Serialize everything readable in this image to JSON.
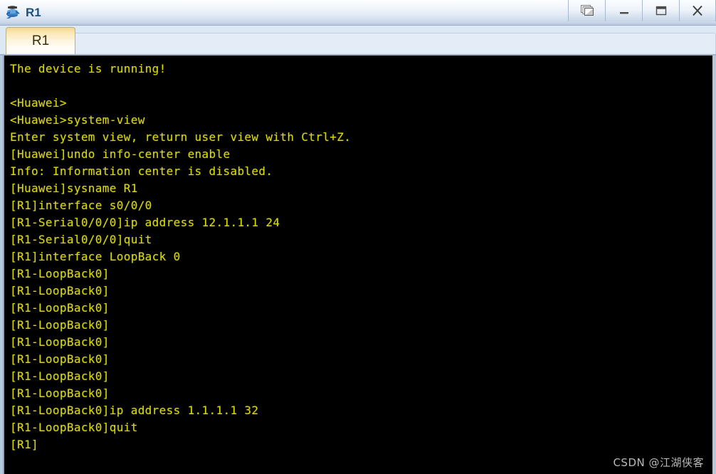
{
  "window": {
    "title": "R1",
    "icon": "router-icon",
    "controls": [
      {
        "name": "restore-windows-button",
        "label": "Restore",
        "icon": "cascade-windows-icon"
      },
      {
        "name": "minimize-button",
        "label": "Minimize",
        "icon": "minimize-icon"
      },
      {
        "name": "maximize-button",
        "label": "Maximize",
        "icon": "maximize-icon"
      },
      {
        "name": "close-button",
        "label": "X",
        "icon": "close-icon"
      }
    ]
  },
  "tabs": [
    {
      "label": "R1",
      "active": true
    }
  ],
  "terminal": {
    "background": "#000000",
    "foreground": "#d9d900",
    "lines": [
      "The device is running!",
      "",
      "<Huawei>",
      "<Huawei>system-view",
      "Enter system view, return user view with Ctrl+Z.",
      "[Huawei]undo info-center enable",
      "Info: Information center is disabled.",
      "[Huawei]sysname R1",
      "[R1]interface s0/0/0",
      "[R1-Serial0/0/0]ip address 12.1.1.1 24",
      "[R1-Serial0/0/0]quit",
      "[R1]interface LoopBack 0",
      "[R1-LoopBack0]",
      "[R1-LoopBack0]",
      "[R1-LoopBack0]",
      "[R1-LoopBack0]",
      "[R1-LoopBack0]",
      "[R1-LoopBack0]",
      "[R1-LoopBack0]",
      "[R1-LoopBack0]",
      "[R1-LoopBack0]ip address 1.1.1.1 32",
      "[R1-LoopBack0]quit",
      "[R1]"
    ]
  },
  "watermark": {
    "text": "CSDN @江湖侠客"
  },
  "colors": {
    "titlebar_top": "#fdfeff",
    "titlebar_bottom": "#b8c8dc",
    "tab_active_top": "#f6d88e",
    "tabstrip_bg": "#dde8f5",
    "terminal_text": "#d9d900",
    "title_text": "#1f4e79"
  }
}
